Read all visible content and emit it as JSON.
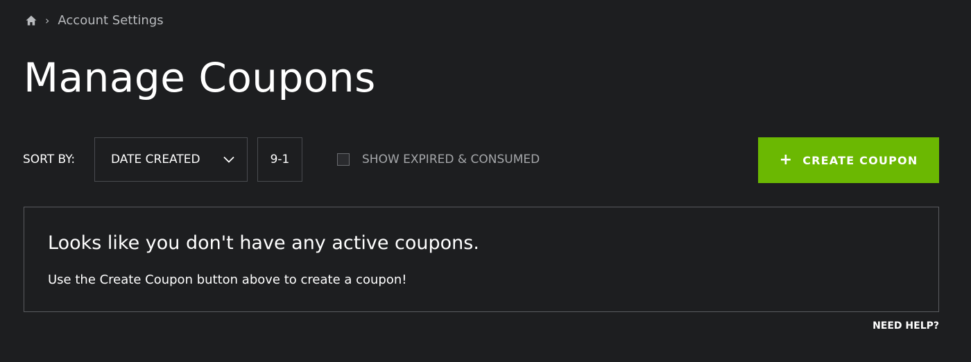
{
  "breadcrumb": {
    "home_icon": "home-icon",
    "separator_icon": "chevron-right-icon",
    "current": "Account Settings"
  },
  "page": {
    "title": "Manage Coupons"
  },
  "toolbar": {
    "sort_label": "SORT BY:",
    "sort_value": "DATE CREATED",
    "sort_order": "9-1",
    "show_expired_label": "SHOW EXPIRED & CONSUMED",
    "show_expired_checked": false,
    "create_label": "CREATE COUPON",
    "create_icon": "plus-icon"
  },
  "empty_state": {
    "heading": "Looks like you don't have any active coupons.",
    "message": "Use the Create Coupon button above to create a coupon!"
  },
  "footer": {
    "help_label": "NEED HELP?"
  },
  "colors": {
    "background": "#1d1e20",
    "accent": "#6bb802",
    "border": "#4a4c50"
  }
}
